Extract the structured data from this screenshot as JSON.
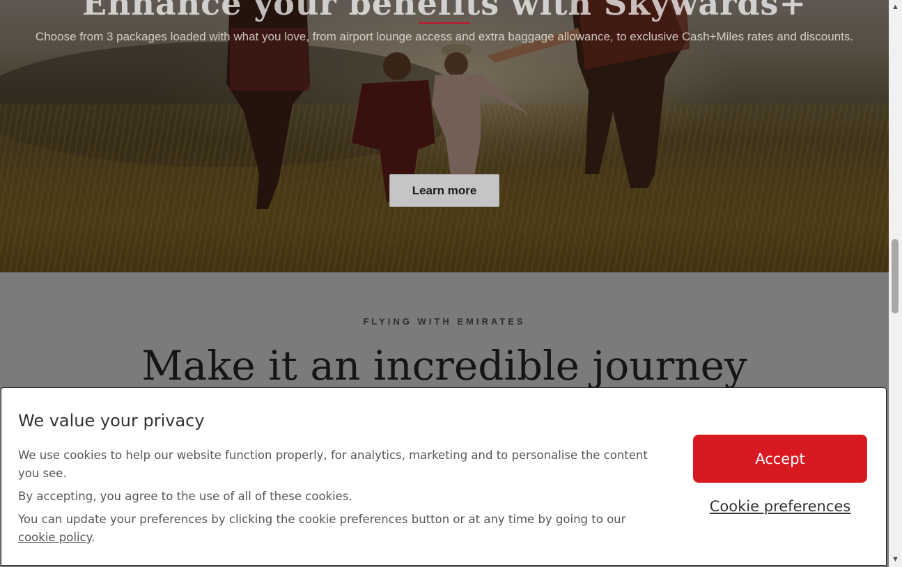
{
  "hero": {
    "title": "Enhance your benefits with Skywards+",
    "subtitle": "Choose from 3 packages loaded with what you love, from airport lounge access and extra baggage allowance, to exclusive Cash+Miles rates and discounts.",
    "cta_label": "Learn more",
    "accent_color": "#c8102e"
  },
  "section": {
    "eyebrow": "FLYING WITH EMIRATES",
    "title": "Make it an incredible journey"
  },
  "cookie_banner": {
    "title": "We value your privacy",
    "paragraph_1": "We use cookies to help our website function properly, for analytics, marketing and to personalise the content you see.",
    "paragraph_2": "By accepting, you agree to the use of all of these cookies.",
    "paragraph_3_prefix": "You can update your preferences by clicking the cookie preferences button or at any time by going to our ",
    "paragraph_3_link": "cookie policy",
    "paragraph_3_suffix": ".",
    "accept_label": "Accept",
    "preferences_label": "Cookie preferences",
    "accept_color": "#d71921"
  },
  "scrollbar": {
    "up_icon": "arrow-up-icon",
    "down_icon": "arrow-down-icon"
  }
}
